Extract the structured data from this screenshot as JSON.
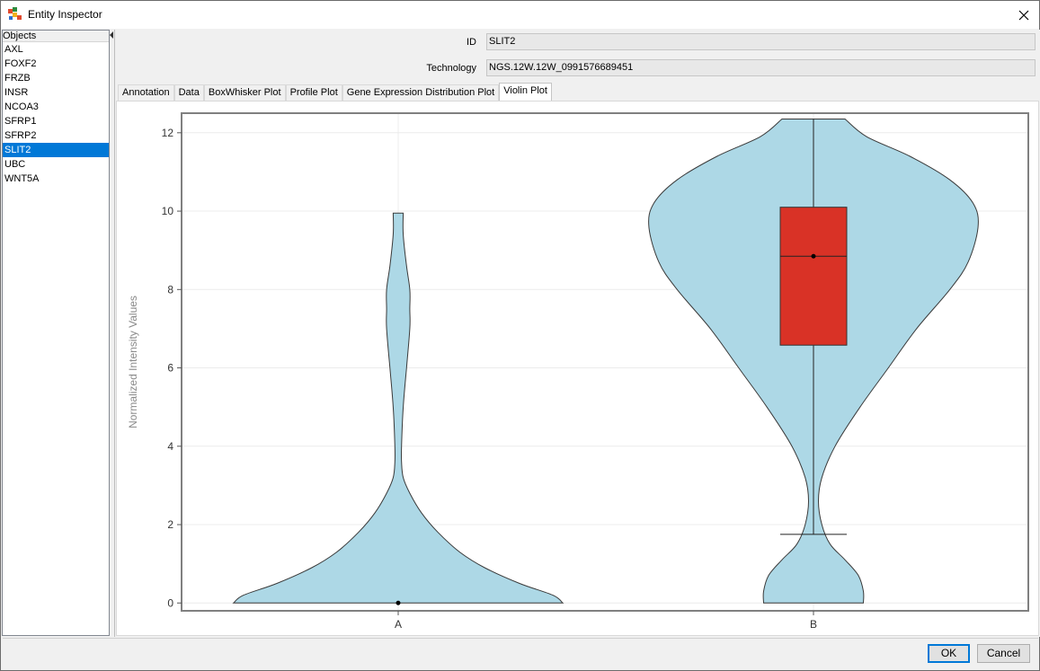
{
  "window": {
    "title": "Entity Inspector"
  },
  "objects_panel": {
    "header": "Objects",
    "items": [
      "AXL",
      "FOXF2",
      "FRZB",
      "INSR",
      "NCOA3",
      "SFRP1",
      "SFRP2",
      "SLIT2",
      "UBC",
      "WNT5A"
    ],
    "selected": "SLIT2"
  },
  "fields": {
    "id_label": "ID",
    "id_value": "SLIT2",
    "technology_label": "Technology",
    "technology_value": "NGS.12W.12W_0991576689451"
  },
  "tabs": [
    {
      "label": "Annotation",
      "active": false
    },
    {
      "label": "Data",
      "active": false
    },
    {
      "label": "BoxWhisker Plot",
      "active": false
    },
    {
      "label": "Profile Plot",
      "active": false
    },
    {
      "label": "Gene Expression Distribution Plot",
      "active": false
    },
    {
      "label": "Violin Plot",
      "active": true
    }
  ],
  "buttons": {
    "ok": "OK",
    "cancel": "Cancel"
  },
  "colors": {
    "violin_fill": "#add8e6",
    "box_fill": "#d93226",
    "selection": "#0078d7"
  },
  "chart_data": {
    "type": "violin",
    "categories": [
      "A",
      "B"
    ],
    "ylabel": "Normalized Intensity Values",
    "xlabel": "",
    "ylim": [
      -0.2,
      12.5
    ],
    "yticks": [
      0,
      2,
      4,
      6,
      8,
      10,
      12
    ],
    "grid": true,
    "violins": [
      {
        "name": "A",
        "range": [
          0,
          9.95
        ],
        "profile": [
          [
            0,
            0.99
          ],
          [
            0.2,
            0.93
          ],
          [
            0.5,
            0.73
          ],
          [
            0.9,
            0.52
          ],
          [
            1.3,
            0.37
          ],
          [
            1.8,
            0.24
          ],
          [
            2.3,
            0.14
          ],
          [
            2.8,
            0.07
          ],
          [
            3.2,
            0.03
          ],
          [
            3.6,
            0.02
          ],
          [
            4,
            0.02
          ],
          [
            5,
            0.03
          ],
          [
            6,
            0.05
          ],
          [
            7,
            0.07
          ],
          [
            7.5,
            0.07
          ],
          [
            8,
            0.07
          ],
          [
            8.6,
            0.05
          ],
          [
            9.4,
            0.03
          ],
          [
            9.95,
            0.03
          ]
        ],
        "median": 0
      },
      {
        "name": "B",
        "range": [
          0,
          12.35
        ],
        "profile": [
          [
            0,
            0.3
          ],
          [
            0.3,
            0.3
          ],
          [
            0.7,
            0.27
          ],
          [
            1.1,
            0.19
          ],
          [
            1.5,
            0.1
          ],
          [
            2.0,
            0.05
          ],
          [
            2.6,
            0.03
          ],
          [
            3.2,
            0.05
          ],
          [
            4,
            0.13
          ],
          [
            5,
            0.28
          ],
          [
            6,
            0.45
          ],
          [
            7,
            0.62
          ],
          [
            8,
            0.82
          ],
          [
            8.7,
            0.93
          ],
          [
            9.6,
            0.99
          ],
          [
            10.2,
            0.96
          ],
          [
            10.8,
            0.82
          ],
          [
            11.4,
            0.58
          ],
          [
            11.9,
            0.32
          ],
          [
            12.35,
            0.19
          ]
        ],
        "median": 8.85,
        "q1": 6.58,
        "q3": 10.1,
        "whisker_low": 1.75,
        "whisker_high": 12.35
      }
    ]
  }
}
